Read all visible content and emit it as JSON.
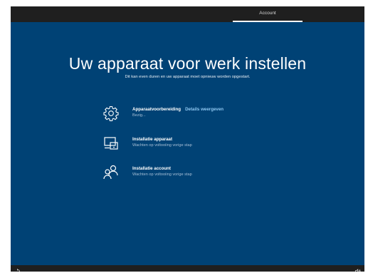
{
  "topbar": {
    "tab_label": "Account"
  },
  "main": {
    "title": "Uw apparaat voor werk instellen",
    "subtitle": "Dit kan even duren en uw apparaat moet opnieuw worden opgestart."
  },
  "steps": [
    {
      "icon": "gear-icon",
      "name": "Apparaatvoorbereiding",
      "link": "Details weergeven",
      "status": "Bezig..."
    },
    {
      "icon": "device-setup-icon",
      "name": "Installatie apparaat",
      "status": "Wachten op voltooiing vorige stap"
    },
    {
      "icon": "users-icon",
      "name": "Installatie account",
      "status": "Wachten op voltooiing vorige stap"
    }
  ],
  "bottombar": {
    "left_icon": "ease-of-access-icon",
    "right_icon": "volume-icon"
  },
  "colors": {
    "background": "#004275",
    "frame": "#1f1f1f",
    "link": "#8fc8f2"
  }
}
